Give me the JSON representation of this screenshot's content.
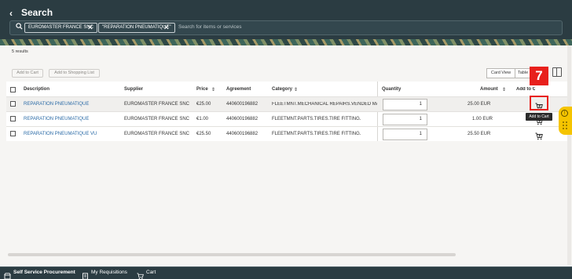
{
  "header": {
    "back_glyph": "‹",
    "title": "Search",
    "search": {
      "chips": [
        "EUROMASTER FRANCE SNC",
        "\"REPARATION PNEUMATIQUE\""
      ],
      "placeholder": "Search for items or services"
    }
  },
  "toolbar": {
    "results": "5 results",
    "add_to_cart": "Add to Cart",
    "add_to_shopping_list": "Add to Shopping List",
    "card_view": "Card View",
    "table_view": "Table"
  },
  "table": {
    "columns": [
      "Description",
      "Supplier",
      "Price",
      "Agreement",
      "Category",
      "Quantity",
      "Amount",
      "Add to Cart"
    ],
    "rows": [
      {
        "description": "REPARATION PNEUMATIQUE",
        "supplier": "EUROMASTER FRANCE SNC",
        "price": "€25.00",
        "agreement": "440600196882",
        "category": "FLEETMNT.MECHANICAL REPAIRS.VENDED MA",
        "quantity": "1",
        "amount": "25.00 EUR"
      },
      {
        "description": "REPARATION PNEUMATIQUE",
        "supplier": "EUROMASTER FRANCE SNC",
        "price": "€1.00",
        "agreement": "440600196882",
        "category": "FLEETMNT.PARTS.TIRES.TIRE FITTING.",
        "quantity": "1",
        "amount": "1.00 EUR"
      },
      {
        "description": "REPARATION PNEUMATIQUE VU",
        "supplier": "EUROMASTER FRANCE SNC",
        "price": "€25.50",
        "agreement": "440600196882",
        "category": "FLEETMNT.PARTS.TIRES.TIRE FITTING.",
        "quantity": "1",
        "amount": "25.50 EUR"
      }
    ]
  },
  "callout": {
    "step": "7",
    "tooltip": "Add to Cart"
  },
  "footer": {
    "self_service": "Self Service Procurement",
    "my_requisitions": "My Requisitions",
    "cart": "Cart"
  },
  "colors": {
    "header_bg": "#2b3c42",
    "link": "#2a6aa6",
    "callout": "#e8201c",
    "side_tab": "#f5c400"
  }
}
